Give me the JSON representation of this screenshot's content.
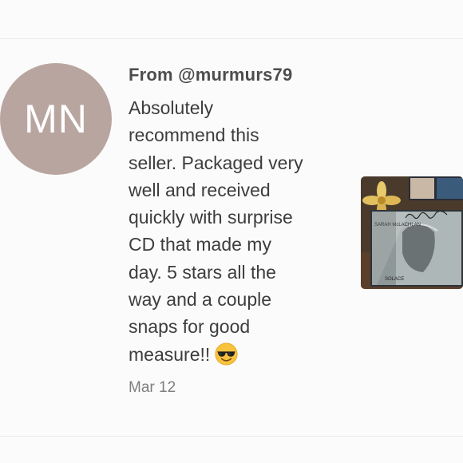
{
  "avatar": {
    "initials": "MN",
    "color": "#b9a5a0"
  },
  "comment": {
    "author": "From @murmurs79",
    "lines": [
      "Absolutely",
      "recommend this",
      "seller. Packaged very",
      "well and received",
      "quickly with surprise",
      "CD that made my",
      "day. 5 stars all the",
      "way and a couple",
      "snaps for good",
      "measure!!"
    ],
    "emoji_icon": "smiling-face-with-sunglasses",
    "date": "Mar 12"
  },
  "photo": {
    "icon": "cd-photo",
    "album_text_1": "SARAH McLACHLAN",
    "album_text_2": "SOLACE"
  },
  "colors": {
    "author_text": "#4d4d4d",
    "body_text": "#3d3d3d",
    "date_text": "#7e7e7e"
  }
}
